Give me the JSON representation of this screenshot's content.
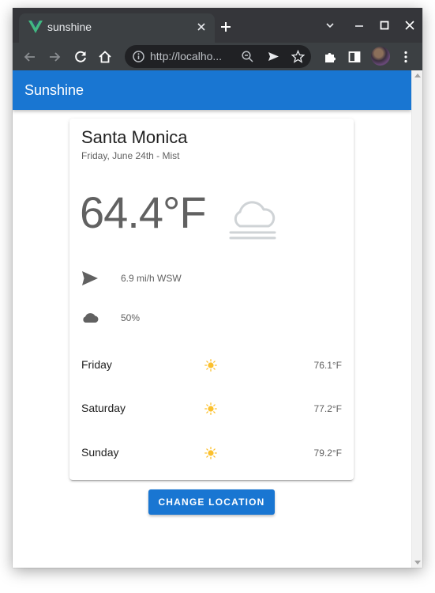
{
  "browser": {
    "tab_title": "sunshine",
    "url": "http://localho...",
    "theme": {
      "titlebar": "#35363a",
      "toolbar": "#3c4043",
      "accent_vue": "#41b883"
    }
  },
  "app": {
    "title": "Sunshine",
    "primary_color": "#1976d2"
  },
  "weather": {
    "city": "Santa Monica",
    "subtitle": "Friday, June 24th - Mist",
    "temperature": "64.4°F",
    "condition_icon": "mist-cloud-icon",
    "wind": "6.9 mi/h WSW",
    "cloud_cover": "50%"
  },
  "forecast": [
    {
      "day": "Friday",
      "icon": "sun-icon",
      "temp": "76.1°F"
    },
    {
      "day": "Saturday",
      "icon": "sun-icon",
      "temp": "77.2°F"
    },
    {
      "day": "Sunday",
      "icon": "sun-icon",
      "temp": "79.2°F"
    }
  ],
  "actions": {
    "change_location": "CHANGE LOCATION"
  }
}
